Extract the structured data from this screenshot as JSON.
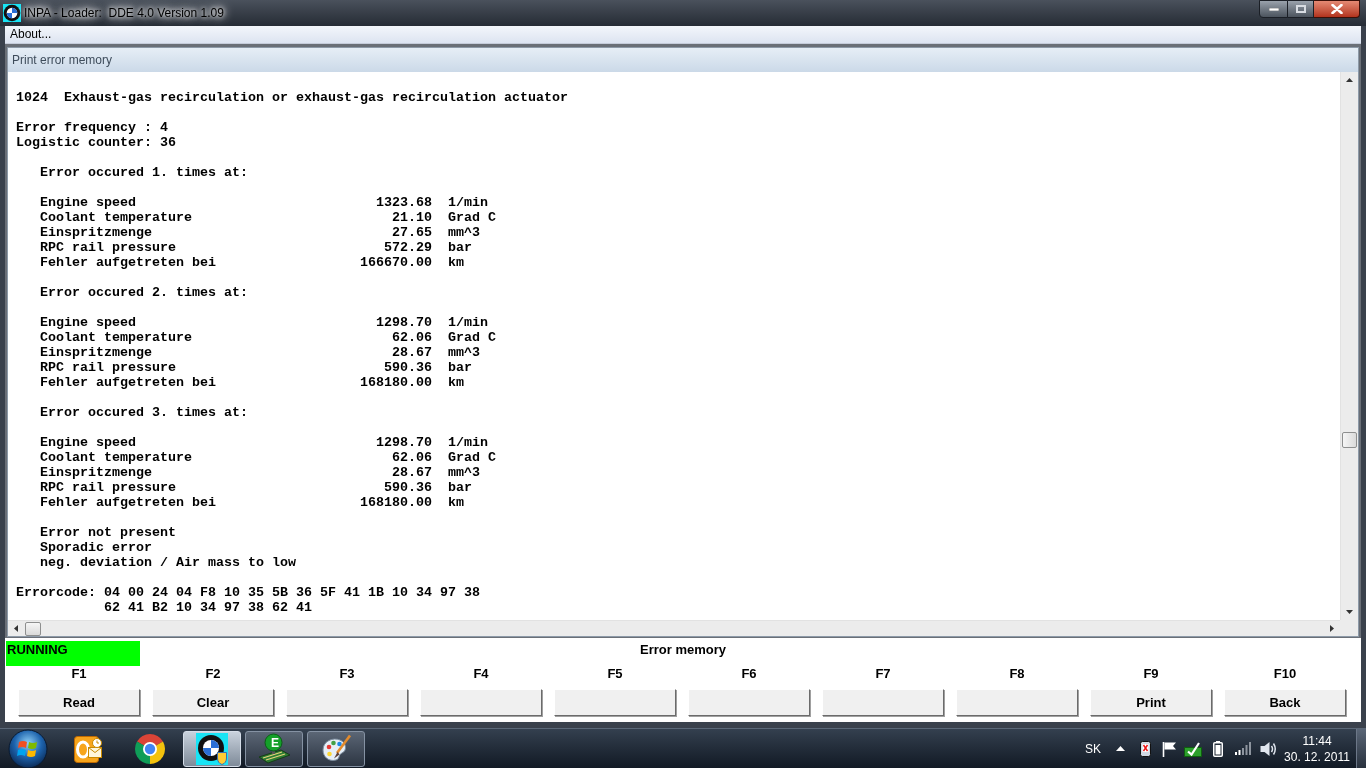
{
  "window": {
    "title": "INPA - Loader:  DDE 4.0 Version 1.09"
  },
  "menu": [
    "About..."
  ],
  "child_window": {
    "title": "Print error memory"
  },
  "report": {
    "fault_code": "1024",
    "fault_text": "Exhaust-gas recirculation or exhaust-gas recirculation actuator",
    "summary": [
      {
        "label": "Error frequency :",
        "value": "4"
      },
      {
        "label": "Logistic counter:",
        "value": "36"
      }
    ],
    "occurrences": [
      {
        "title": "Error occured 1. times at:",
        "rows": [
          {
            "label": "Engine speed",
            "value": "1323.68",
            "unit": "1/min"
          },
          {
            "label": "Coolant temperature",
            "value": "21.10",
            "unit": "Grad C"
          },
          {
            "label": "Einspritzmenge",
            "value": "27.65",
            "unit": "mm^3"
          },
          {
            "label": "RPC rail pressure",
            "value": "572.29",
            "unit": "bar"
          },
          {
            "label": "Fehler aufgetreten bei",
            "value": "166670.00",
            "unit": "km"
          }
        ]
      },
      {
        "title": "Error occured 2. times at:",
        "rows": [
          {
            "label": "Engine speed",
            "value": "1298.70",
            "unit": "1/min"
          },
          {
            "label": "Coolant temperature",
            "value": "62.06",
            "unit": "Grad C"
          },
          {
            "label": "Einspritzmenge",
            "value": "28.67",
            "unit": "mm^3"
          },
          {
            "label": "RPC rail pressure",
            "value": "590.36",
            "unit": "bar"
          },
          {
            "label": "Fehler aufgetreten bei",
            "value": "168180.00",
            "unit": "km"
          }
        ]
      },
      {
        "title": "Error occured 3. times at:",
        "rows": [
          {
            "label": "Engine speed",
            "value": "1298.70",
            "unit": "1/min"
          },
          {
            "label": "Coolant temperature",
            "value": "62.06",
            "unit": "Grad C"
          },
          {
            "label": "Einspritzmenge",
            "value": "28.67",
            "unit": "mm^3"
          },
          {
            "label": "RPC rail pressure",
            "value": "590.36",
            "unit": "bar"
          },
          {
            "label": "Fehler aufgetreten bei",
            "value": "168180.00",
            "unit": "km"
          }
        ]
      }
    ],
    "status_lines": [
      "Error not present",
      "Sporadic error",
      "neg. deviation / Air mass to low"
    ],
    "errorcode": {
      "label": "Errorcode:",
      "lines": [
        "04 00 24 04 F8 10 35 5B 36 5F 41 1B 10 34 97 38",
        "62 41 B2 10 34 97 38 62 41"
      ]
    }
  },
  "status_bar": {
    "state": "RUNNING",
    "title": "Error memory"
  },
  "function_keys": [
    {
      "key": "F1",
      "label": "Read"
    },
    {
      "key": "F2",
      "label": "Clear"
    },
    {
      "key": "F3"
    },
    {
      "key": "F4"
    },
    {
      "key": "F5"
    },
    {
      "key": "F6"
    },
    {
      "key": "F7"
    },
    {
      "key": "F8"
    },
    {
      "key": "F9",
      "label": "Print"
    },
    {
      "key": "F10",
      "label": "Back"
    }
  ],
  "taskbar": {
    "apps": [
      {
        "running": false,
        "selected": false
      },
      {
        "running": false,
        "selected": false
      },
      {
        "running": true,
        "selected": true
      },
      {
        "running": true,
        "selected": false,
        "label": "E"
      },
      {
        "running": true,
        "selected": false
      }
    ],
    "language": "SK",
    "time": "11:44",
    "date": "30. 12. 2011"
  }
}
